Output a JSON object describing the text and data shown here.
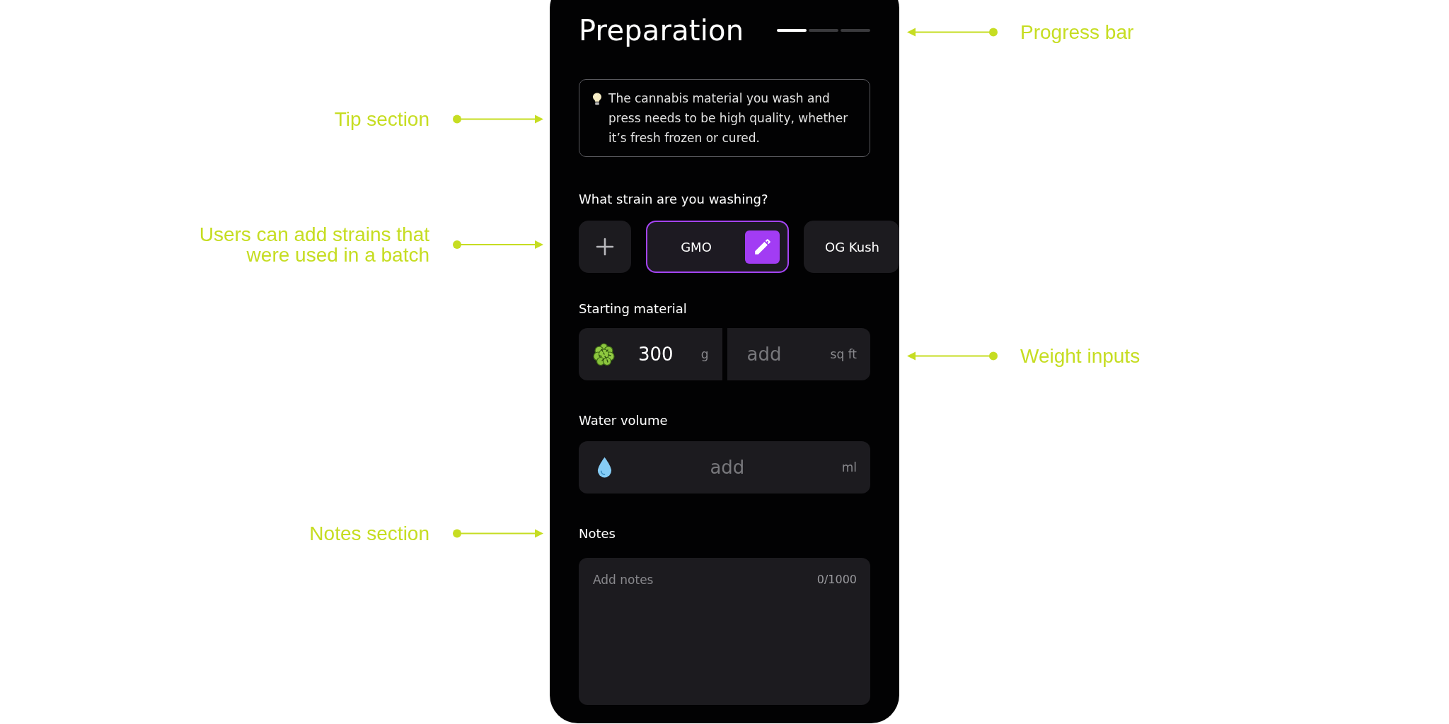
{
  "header": {
    "title": "Preparation",
    "progress_steps": [
      {
        "complete": true
      },
      {
        "complete": false
      },
      {
        "complete": false
      }
    ]
  },
  "tip": {
    "text": "The cannabis material you wash and press needs to be high quality, whether it’s fresh frozen or cured."
  },
  "strain_section": {
    "label": "What strain are you washing?",
    "strains": [
      {
        "name": "GMO",
        "selected": true
      },
      {
        "name": "OG Kush",
        "selected": false
      }
    ]
  },
  "starting_material": {
    "label": "Starting material",
    "fields": [
      {
        "kind": "weight",
        "value": "300",
        "unit": "g"
      },
      {
        "kind": "area",
        "placeholder": "add",
        "unit": "sq ft"
      }
    ]
  },
  "water_volume": {
    "label": "Water volume",
    "field": {
      "placeholder": "add",
      "unit": "ml"
    }
  },
  "notes": {
    "label": "Notes",
    "field": {
      "placeholder": "Add notes",
      "counter": "0/1000"
    }
  },
  "annotations": [
    {
      "text": "Progress bar",
      "kind": "right"
    },
    {
      "text": "Tip section",
      "kind": "left"
    },
    {
      "text": "Users can add strains that were used in a batch",
      "kind": "left"
    },
    {
      "text": "Weight inputs",
      "kind": "right"
    },
    {
      "text": "Notes section",
      "kind": "left"
    }
  ]
}
